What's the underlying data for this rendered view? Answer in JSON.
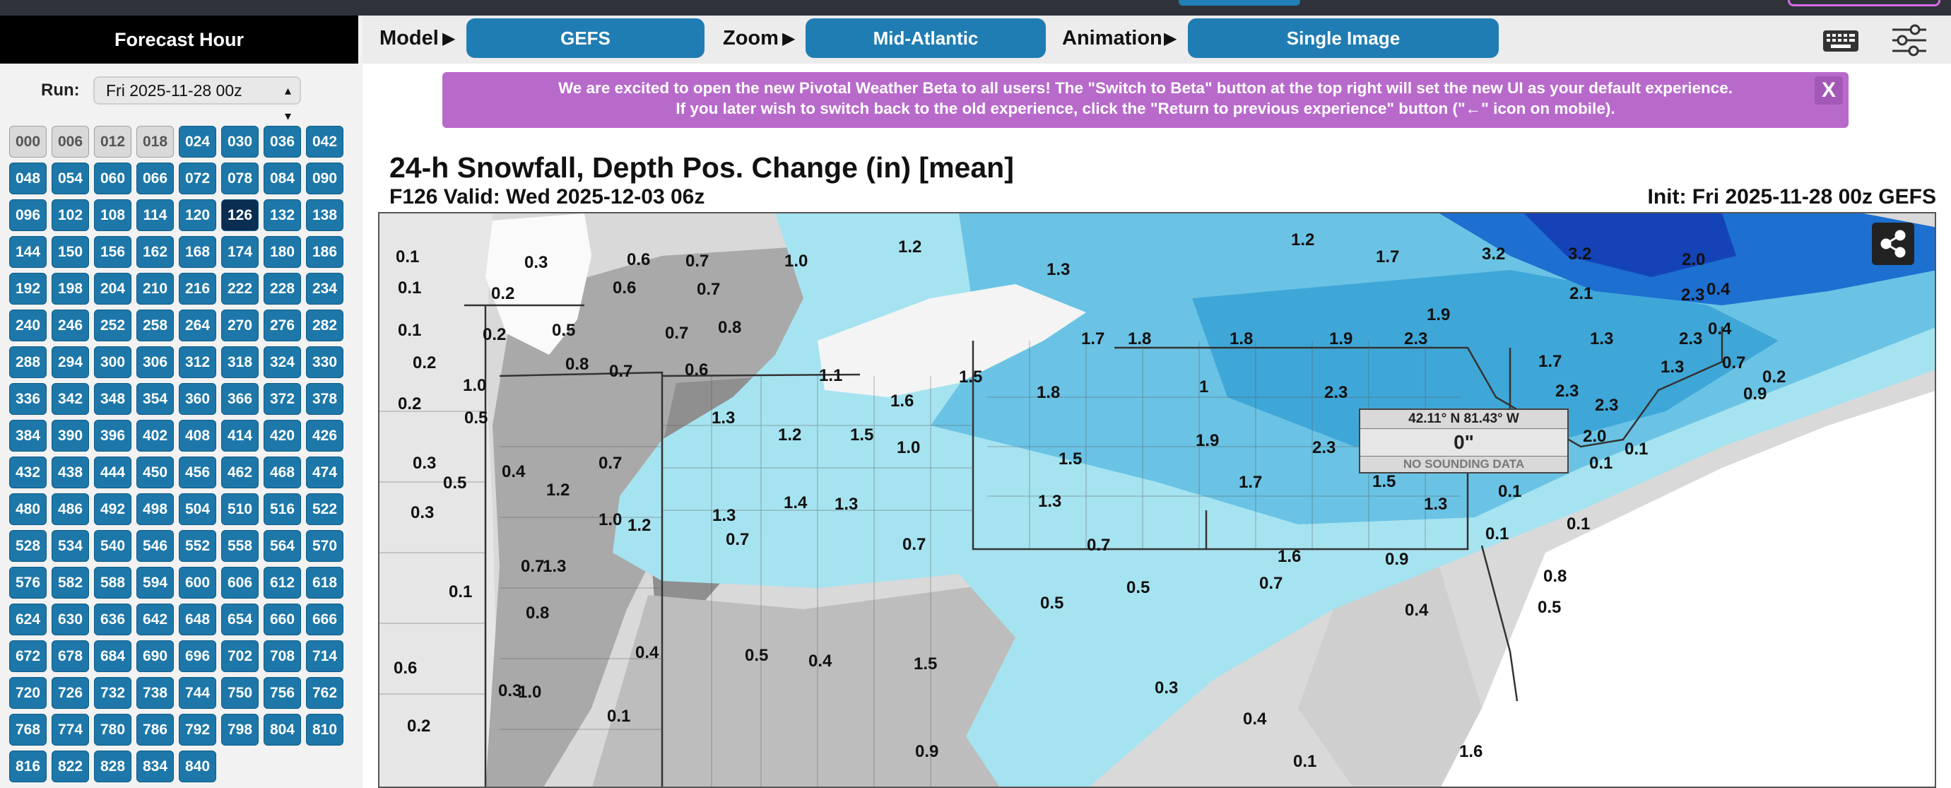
{
  "sidebar": {
    "title": "Forecast Hour",
    "run_label": "Run:",
    "run_value": "Fri 2025-11-28 00z",
    "hours": [
      "000",
      "006",
      "012",
      "018",
      "024",
      "030",
      "036",
      "042",
      "048",
      "054",
      "060",
      "066",
      "072",
      "078",
      "084",
      "090",
      "096",
      "102",
      "108",
      "114",
      "120",
      "126",
      "132",
      "138",
      "144",
      "150",
      "156",
      "162",
      "168",
      "174",
      "180",
      "186",
      "192",
      "198",
      "204",
      "210",
      "216",
      "222",
      "228",
      "234",
      "240",
      "246",
      "252",
      "258",
      "264",
      "270",
      "276",
      "282",
      "288",
      "294",
      "300",
      "306",
      "312",
      "318",
      "324",
      "330",
      "336",
      "342",
      "348",
      "354",
      "360",
      "366",
      "372",
      "378",
      "384",
      "390",
      "396",
      "402",
      "408",
      "414",
      "420",
      "426",
      "432",
      "438",
      "444",
      "450",
      "456",
      "462",
      "468",
      "474",
      "480",
      "486",
      "492",
      "498",
      "504",
      "510",
      "516",
      "522",
      "528",
      "534",
      "540",
      "546",
      "552",
      "558",
      "564",
      "570",
      "576",
      "582",
      "588",
      "594",
      "600",
      "606",
      "612",
      "618",
      "624",
      "630",
      "636",
      "642",
      "648",
      "654",
      "660",
      "666",
      "672",
      "678",
      "684",
      "690",
      "696",
      "702",
      "708",
      "714",
      "720",
      "726",
      "732",
      "738",
      "744",
      "750",
      "756",
      "762",
      "768",
      "774",
      "780",
      "786",
      "792",
      "798",
      "804",
      "810",
      "816",
      "822",
      "828",
      "834",
      "840"
    ],
    "past_hours": [
      "000",
      "006",
      "012",
      "018"
    ],
    "selected_hour": "126"
  },
  "toolbar": {
    "model_label": "Model",
    "model_value": "GEFS",
    "zoom_label": "Zoom",
    "zoom_value": "Mid-Atlantic",
    "animation_label": "Animation",
    "animation_value": "Single Image",
    "arrow": "▶",
    "icons": [
      "keyboard-icon",
      "settings-sliders-icon"
    ]
  },
  "banner": {
    "line1": "We are excited to open the new Pivotal Weather Beta to all users! The \"Switch to Beta\" button at the top right will set the new UI as your default experience.",
    "line2": "If you later wish to switch back to the old experience, click the \"Return to previous experience\" button (\"←\" icon on mobile).",
    "close": "X",
    "color": "#b86acb"
  },
  "map": {
    "title": "24-h Snowfall, Depth Pos. Change (in) [mean]",
    "valid": "F126 Valid: Wed 2025-12-03 06z",
    "init": "Init: Fri 2025-11-28 00z GEFS",
    "probe": {
      "coords": "42.11° N 81.43° W",
      "value": "0\"",
      "note": "NO SOUNDING DATA"
    },
    "labels": [
      {
        "t": "0.1"
      },
      {
        "t": "0.3"
      },
      {
        "t": "0.6"
      },
      {
        "t": "0.7"
      },
      {
        "t": "1.0"
      },
      {
        "t": "1.2"
      },
      {
        "t": "1.3"
      },
      {
        "t": "1.2"
      },
      {
        "t": "1.7"
      },
      {
        "t": "3.2"
      },
      {
        "t": "3.2"
      },
      {
        "t": "2.0"
      },
      {
        "t": "0.1"
      },
      {
        "t": "0.2"
      },
      {
        "t": "0.6"
      },
      {
        "t": "0.7"
      },
      {
        "t": "2.1"
      },
      {
        "t": "2.3"
      },
      {
        "t": "0.4"
      },
      {
        "t": "1.9"
      },
      {
        "t": "0.1"
      },
      {
        "t": "0.2"
      },
      {
        "t": "0.5"
      },
      {
        "t": "0.7"
      },
      {
        "t": "0.8"
      },
      {
        "t": "1.7"
      },
      {
        "t": "1.8"
      },
      {
        "t": "1.8"
      },
      {
        "t": "1.9"
      },
      {
        "t": "2.3"
      },
      {
        "t": "1.3"
      },
      {
        "t": "2.3"
      },
      {
        "t": "0.4"
      },
      {
        "t": "0.2"
      },
      {
        "t": "0.8"
      },
      {
        "t": "0.7"
      },
      {
        "t": "0.6"
      },
      {
        "t": "1.1"
      },
      {
        "t": "1.5"
      },
      {
        "t": "1.7"
      },
      {
        "t": "1.3"
      },
      {
        "t": "0.7"
      },
      {
        "t": "0.2"
      },
      {
        "t": "0.2"
      },
      {
        "t": "1.0"
      },
      {
        "t": "1.6"
      },
      {
        "t": "1.8"
      },
      {
        "t": "1"
      },
      {
        "t": "2.3"
      },
      {
        "t": "2.3"
      },
      {
        "t": "0.9"
      },
      {
        "t": "2.3"
      },
      {
        "t": "0.5"
      },
      {
        "t": "1.3"
      },
      {
        "t": "1.2"
      },
      {
        "t": "1.5"
      },
      {
        "t": "1.4"
      },
      {
        "t": "2.0"
      },
      {
        "t": "0.3"
      },
      {
        "t": "0.4"
      },
      {
        "t": "0.7"
      },
      {
        "t": "1.0"
      },
      {
        "t": "1.5"
      },
      {
        "t": "1.9"
      },
      {
        "t": "2.3"
      },
      {
        "t": "1.0"
      },
      {
        "t": "0.1"
      },
      {
        "t": "0.5"
      },
      {
        "t": "1.2"
      },
      {
        "t": "1.7"
      },
      {
        "t": "1.5"
      },
      {
        "t": "0.1"
      },
      {
        "t": "0.3"
      },
      {
        "t": "1.0"
      },
      {
        "t": "1.2"
      },
      {
        "t": "1.3"
      },
      {
        "t": "1.4"
      },
      {
        "t": "1.3"
      },
      {
        "t": "1.3"
      },
      {
        "t": "1.3"
      },
      {
        "t": "0.1"
      },
      {
        "t": "0.1"
      },
      {
        "t": "0.1"
      },
      {
        "t": "0.8"
      },
      {
        "t": "0.7"
      },
      {
        "t": "0.7"
      },
      {
        "t": "0.7"
      },
      {
        "t": "0.7"
      },
      {
        "t": "1.6"
      },
      {
        "t": "0.9"
      },
      {
        "t": "0.1"
      },
      {
        "t": "1.3"
      },
      {
        "t": "0.5"
      },
      {
        "t": "0.7"
      },
      {
        "t": "0.4"
      },
      {
        "t": "0.5"
      },
      {
        "t": "0.8"
      },
      {
        "t": "0.5"
      },
      {
        "t": "0.6"
      },
      {
        "t": "0.4"
      },
      {
        "t": "0.5"
      },
      {
        "t": "0.4"
      },
      {
        "t": "1.5"
      },
      {
        "t": "0.3"
      },
      {
        "t": "0.3"
      },
      {
        "t": "1.0"
      },
      {
        "t": "0.4"
      },
      {
        "t": "0.2"
      },
      {
        "t": "0.1"
      },
      {
        "t": "0.9"
      },
      {
        "t": "0.1"
      },
      {
        "t": "1.6"
      }
    ]
  }
}
